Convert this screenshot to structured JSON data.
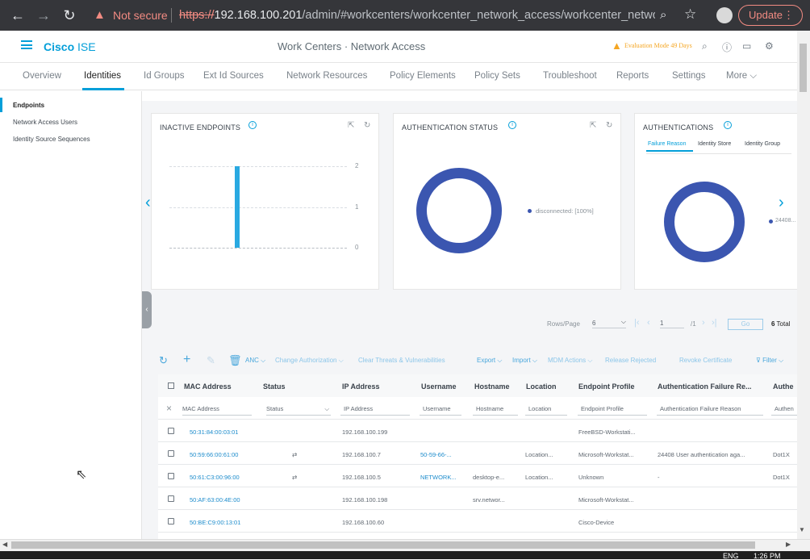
{
  "browser": {
    "not_secure": "Not secure",
    "url_scheme": "https://",
    "url_host": "192.168.100.201",
    "url_path": "/admin/#workcenters/workcenter_network_access/workcenter_network...",
    "update_label": "Update"
  },
  "header": {
    "brand": "Cisco",
    "product": "ISE",
    "page_title": "Work Centers · Network Access",
    "evaluation": "Evaluation Mode 49 Days"
  },
  "tabs": [
    "Overview",
    "Identities",
    "Id Groups",
    "Ext Id Sources",
    "Network Resources",
    "Policy Elements",
    "Policy Sets",
    "Troubleshoot",
    "Reports",
    "Settings",
    "More"
  ],
  "sidebar": {
    "items": [
      "Endpoints",
      "Network Access Users",
      "Identity Source Sequences"
    ]
  },
  "cards": {
    "inactive": {
      "title": "INACTIVE ENDPOINTS",
      "ticks": [
        "2",
        "1",
        "0"
      ]
    },
    "auth_status": {
      "title": "AUTHENTICATION STATUS",
      "legend": "disconnected: [100%]"
    },
    "authentications": {
      "title": "AUTHENTICATIONS",
      "subtabs": [
        "Failure Reason",
        "Identity Store",
        "Identity Group"
      ],
      "legend": "24408..."
    }
  },
  "pager": {
    "rows_label": "Rows/Page",
    "rows_value": "6",
    "page": "1",
    "of": "/1",
    "go": "Go",
    "total_num": "6",
    "total_label": "Total"
  },
  "toolbar": {
    "anc": "ANC",
    "change_auth": "Change Authorization",
    "clear_threats": "Clear Threats & Vulnerabilities",
    "export": "Export",
    "import": "Import",
    "mdm": "MDM Actions",
    "release": "Release Rejected",
    "revoke": "Revoke Certificate",
    "filter": "Filter"
  },
  "table": {
    "headers": [
      "MAC Address",
      "Status",
      "IP Address",
      "Username",
      "Hostname",
      "Location",
      "Endpoint Profile",
      "Authentication Failure Re...",
      "Authe"
    ],
    "filters": [
      "MAC Address",
      "Status",
      "IP Address",
      "Username",
      "Hostname",
      "Location",
      "Endpoint Profile",
      "Authentication Failure Reason",
      "Authen"
    ],
    "rows": [
      {
        "mac": "50:31:84:00:03:01",
        "status": "",
        "ip": "192.168.100.199",
        "user": "",
        "host": "",
        "loc": "",
        "profile": "FreeBSD-Workstati...",
        "fail": "",
        "auth": ""
      },
      {
        "mac": "50:59:66:00:61:00",
        "status": "⇄",
        "ip": "192.168.100.7",
        "user": "50-59-66-...",
        "host": "",
        "loc": "Location...",
        "profile": "Microsoft-Workstat...",
        "fail": "24408 User authentication aga...",
        "auth": "Dot1X"
      },
      {
        "mac": "50:61:C3:00:96:00",
        "status": "⇄",
        "ip": "192.168.100.5",
        "user": "NETWORK...",
        "host": "desktop-e...",
        "loc": "Location...",
        "profile": "Unknown",
        "fail": "-",
        "auth": "Dot1X"
      },
      {
        "mac": "50:AF:63:00:4E:00",
        "status": "",
        "ip": "192.168.100.198",
        "user": "",
        "host": "srv.networ...",
        "loc": "",
        "profile": "Microsoft-Workstat...",
        "fail": "",
        "auth": ""
      },
      {
        "mac": "50:BE:C9:00:13:01",
        "status": "",
        "ip": "192.168.100.60",
        "user": "",
        "host": "",
        "loc": "",
        "profile": "Cisco-Device",
        "fail": "",
        "auth": ""
      }
    ]
  },
  "taskbar": {
    "lang": "ENG",
    "time": "1:26 PM"
  },
  "colors": {
    "accent": "#049fd9",
    "donut": "#3b56b0",
    "bar": "#29a9e1",
    "warning": "#f5a623"
  }
}
